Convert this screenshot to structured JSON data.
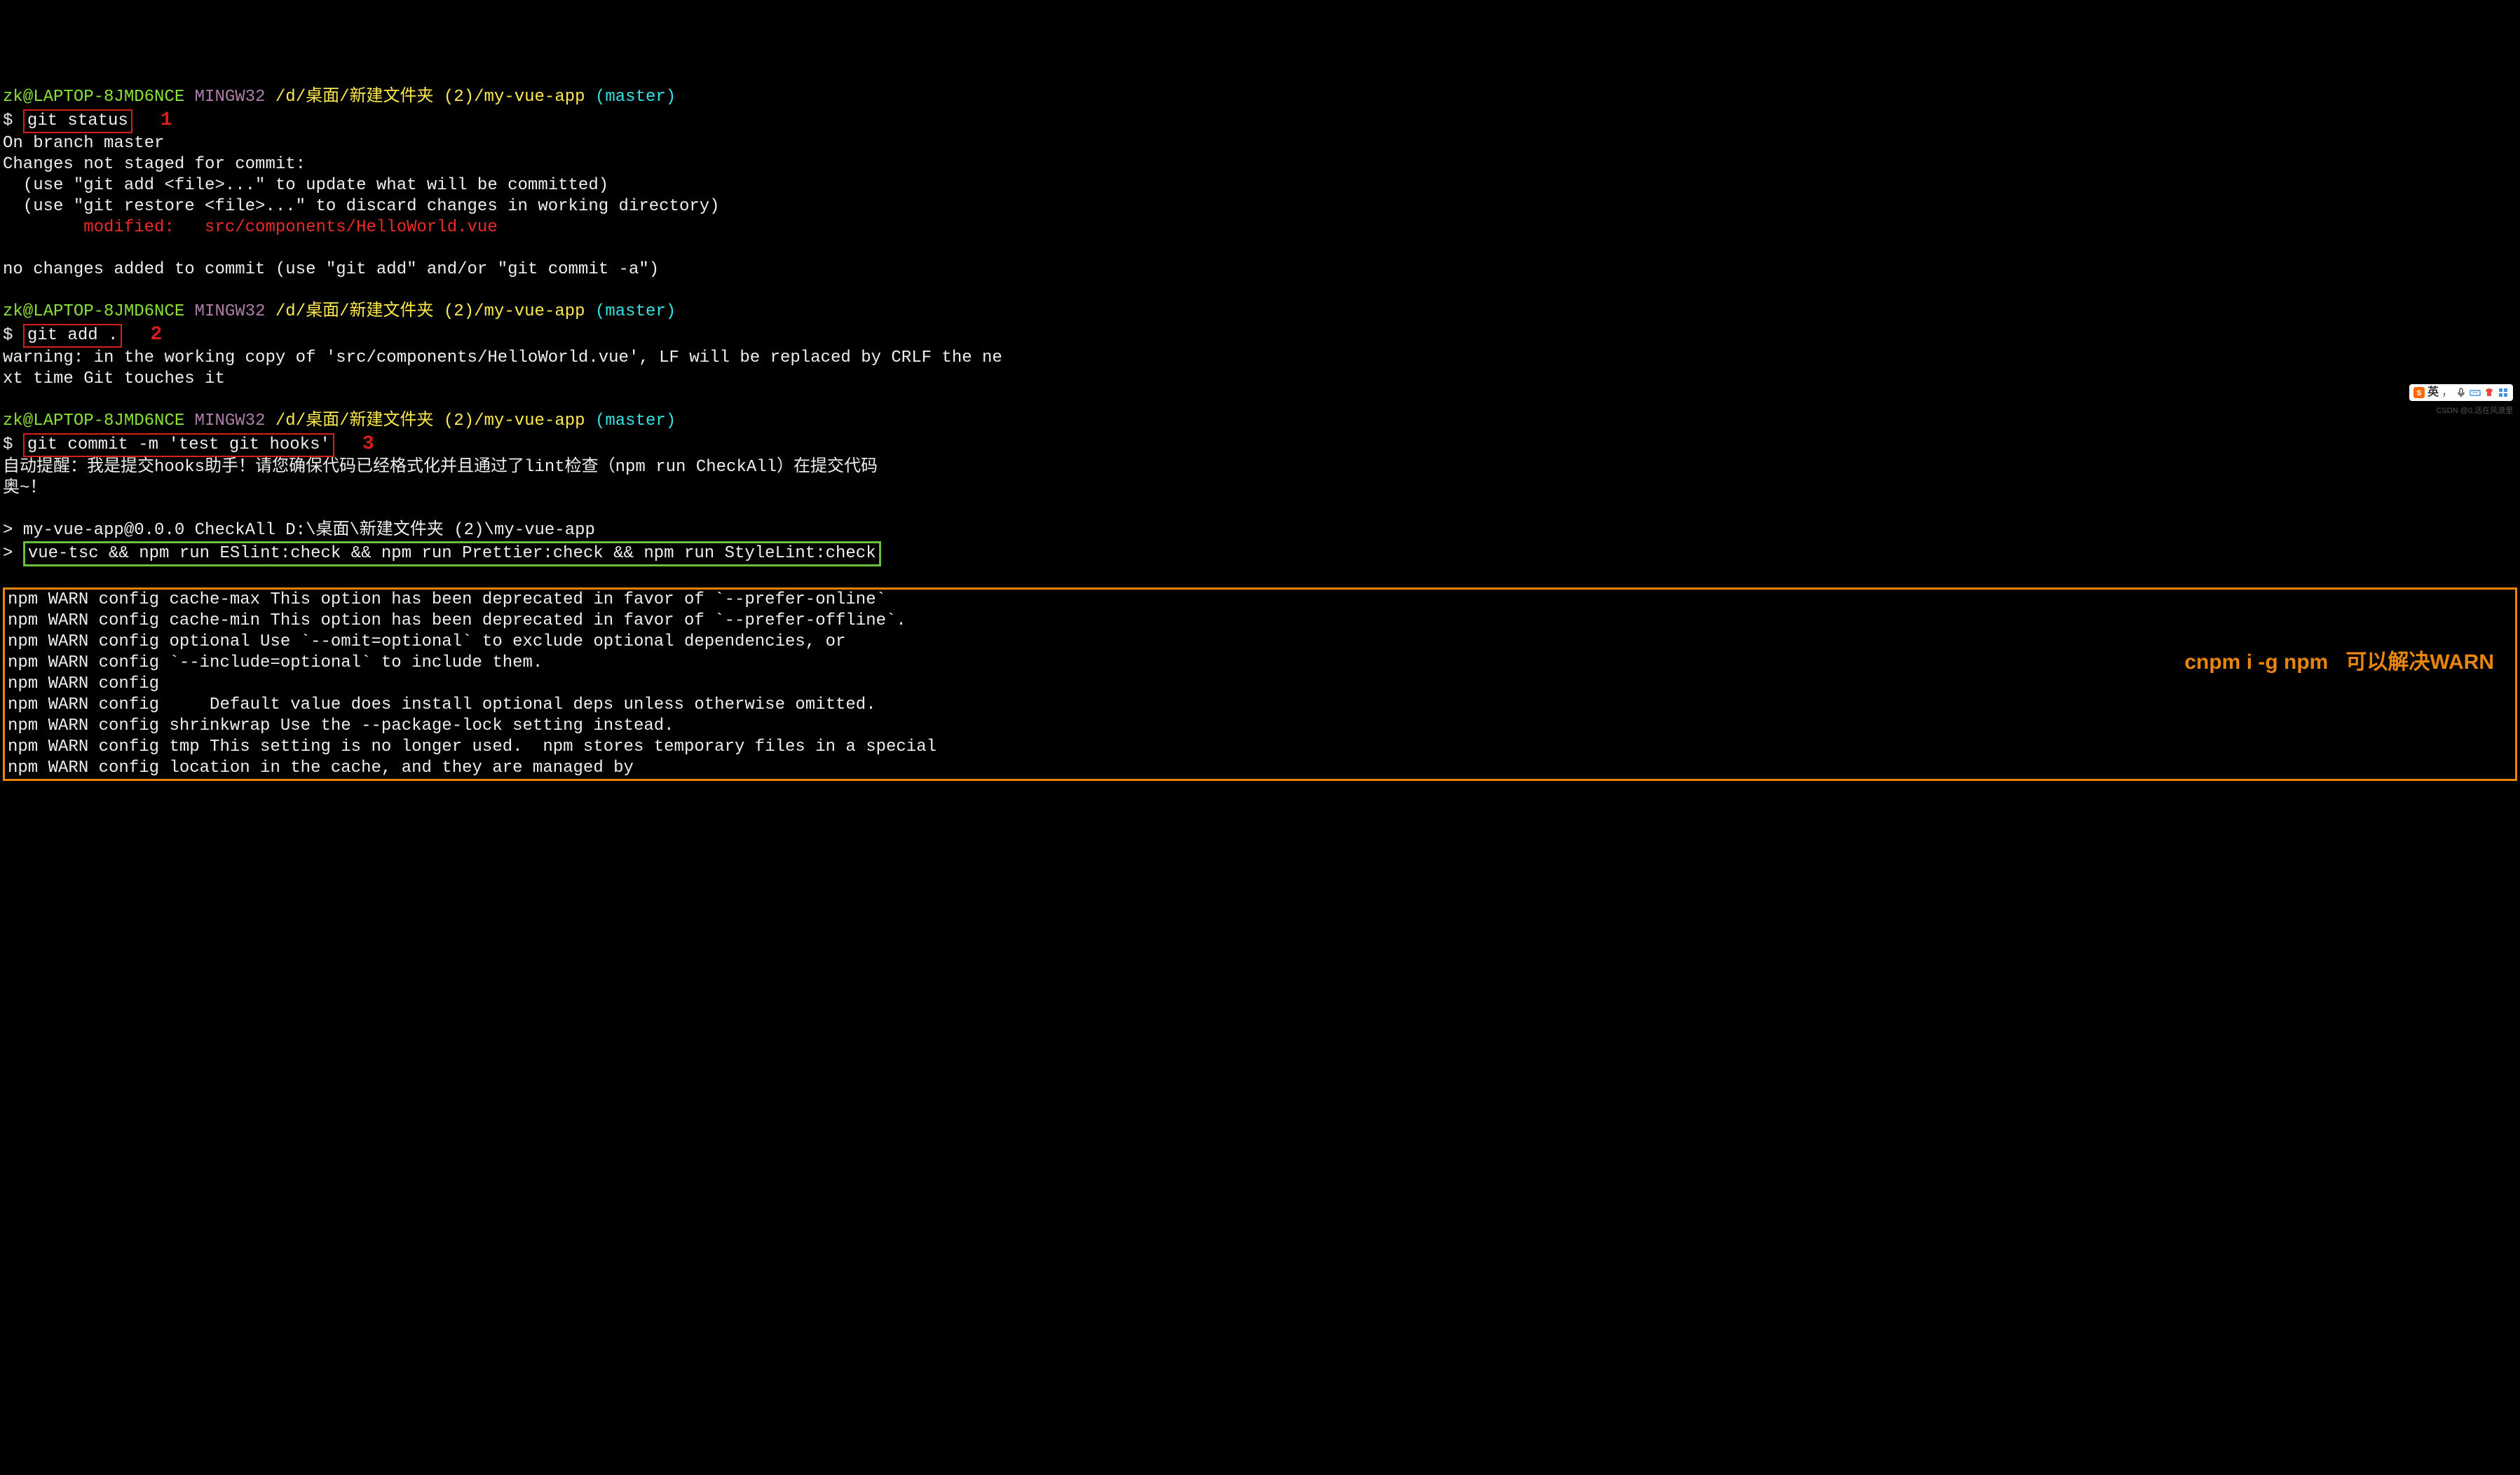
{
  "prompt": {
    "user": "zk@LAPTOP-8JMD6NCE",
    "shell": "MINGW32",
    "path": "/d/桌面/新建文件夹 (2)/my-vue-app",
    "branch": "(master)",
    "sigil": "$ "
  },
  "block1": {
    "cmd": "git status",
    "marker": "1",
    "out": {
      "l1": "On branch master",
      "l2": "Changes not staged for commit:",
      "l3": "  (use \"git add <file>...\" to update what will be committed)",
      "l4": "  (use \"git restore <file>...\" to discard changes in working directory)",
      "l5": "        modified:   src/components/HelloWorld.vue",
      "l6": "no changes added to commit (use \"git add\" and/or \"git commit -a\")"
    }
  },
  "block2": {
    "cmd": "git add .",
    "marker": "2",
    "out": {
      "l1": "warning: in the working copy of 'src/components/HelloWorld.vue', LF will be replaced by CRLF the ne",
      "l2": "xt time Git touches it"
    }
  },
  "block3": {
    "cmd": "git commit -m 'test git hooks'",
    "marker": "3",
    "out": {
      "l1": "自动提醒：我是提交hooks助手！请您确保代码已经格式化并且通过了lint检查（npm run CheckAll）在提交代码",
      "l2": "奥~！",
      "l3": "> my-vue-app@0.0.0 CheckAll D:\\桌面\\新建文件夹 (2)\\my-vue-app",
      "l4_prefix": "> ",
      "l4_cmd": "vue-tsc && npm run ESlint:check && npm run Prettier:check && npm run StyleLint:check"
    }
  },
  "warns": {
    "l1": "npm WARN config cache-max This option has been deprecated in favor of `--prefer-online`",
    "l2": "npm WARN config cache-min This option has been deprecated in favor of `--prefer-offline`.",
    "l3": "npm WARN config optional Use `--omit=optional` to exclude optional dependencies, or",
    "l4": "npm WARN config `--include=optional` to include them.",
    "l5": "npm WARN config",
    "l6": "npm WARN config     Default value does install optional deps unless otherwise omitted.",
    "l7": "npm WARN config shrinkwrap Use the --package-lock setting instead.",
    "l8": "npm WARN config tmp This setting is no longer used.  npm stores temporary files in a special",
    "l9": "npm WARN config location in the cache, and they are managed by"
  },
  "annotation": "cnpm i -g npm   可以解决WARN",
  "ime": {
    "label": "英"
  },
  "watermark": "CSDN @0.活在风浪里"
}
